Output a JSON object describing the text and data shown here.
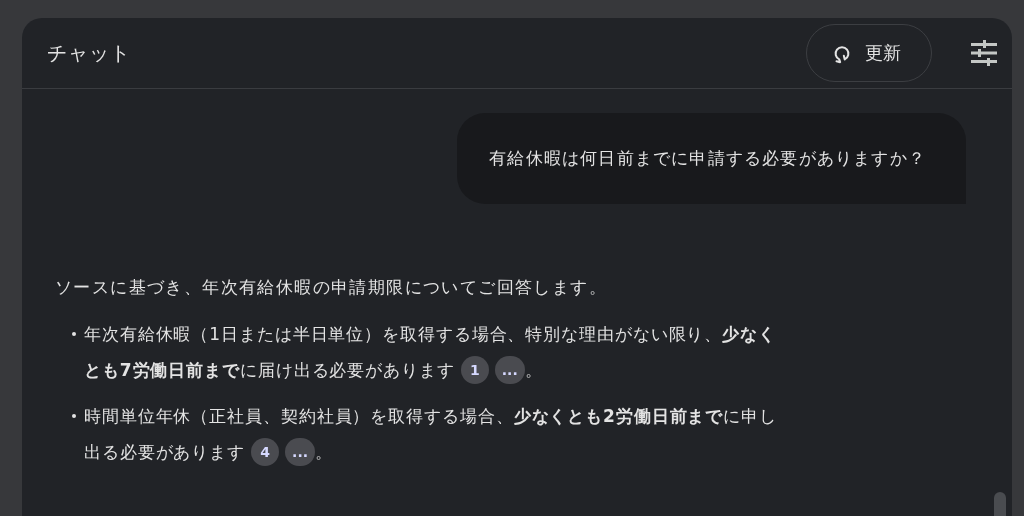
{
  "header": {
    "title": "チャット",
    "refresh_button": "更新"
  },
  "messages": [
    {
      "kind": "user",
      "text": "有給休暇は何日前までに申請する必要がありますか？"
    },
    {
      "kind": "answer",
      "intro": "ソースに基づき、年次有給休暇の申請期限についてご回答します。",
      "bullets": [
        {
          "lines": [
            "年次有給休暇（1日または半日単位）を取得する場合、特別な理由がない限り、**少なく**",
            "**とも7労働日前まで**に届け出る必要があります"
          ],
          "citations": [
            "1",
            "..."
          ],
          "end": "。"
        },
        {
          "lines": [
            "時間単位年休（正社員、契約社員）を取得する場合、**少なくとも2労働日前まで**に申し",
            "出る必要があります"
          ],
          "citations": [
            "4",
            "..."
          ],
          "end": "。"
        }
      ]
    }
  ]
}
